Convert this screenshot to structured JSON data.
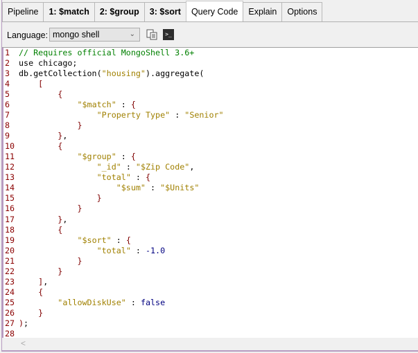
{
  "tabs": [
    {
      "label": "Pipeline",
      "bold": false
    },
    {
      "label": "1: $match",
      "bold": true
    },
    {
      "label": "2: $group",
      "bold": true
    },
    {
      "label": "3: $sort",
      "bold": true
    },
    {
      "label": "Query Code",
      "bold": false,
      "active": true
    },
    {
      "label": "Explain",
      "bold": false
    },
    {
      "label": "Options",
      "bold": false
    }
  ],
  "toolbar": {
    "language_label": "Language:",
    "language_value": "mongo shell"
  },
  "code": [
    [
      [
        "comment",
        "// Requires official MongoShell 3.6+"
      ]
    ],
    [
      [
        "plain",
        "use chicago;"
      ]
    ],
    [
      [
        "plain",
        "db.getCollection("
      ],
      [
        "string",
        "\"housing\""
      ],
      [
        "plain",
        ").aggregate("
      ]
    ],
    [
      [
        "plain",
        "    "
      ],
      [
        "brace",
        "["
      ]
    ],
    [
      [
        "plain",
        "        "
      ],
      [
        "brace",
        "{"
      ]
    ],
    [
      [
        "plain",
        "            "
      ],
      [
        "string",
        "\"$match\""
      ],
      [
        "plain",
        " : "
      ],
      [
        "brace",
        "{"
      ]
    ],
    [
      [
        "plain",
        "                "
      ],
      [
        "string",
        "\"Property Type\""
      ],
      [
        "plain",
        " : "
      ],
      [
        "string",
        "\"Senior\""
      ]
    ],
    [
      [
        "plain",
        "            "
      ],
      [
        "brace",
        "}"
      ]
    ],
    [
      [
        "plain",
        "        "
      ],
      [
        "brace",
        "}"
      ],
      [
        "plain",
        ","
      ]
    ],
    [
      [
        "plain",
        "        "
      ],
      [
        "brace",
        "{"
      ]
    ],
    [
      [
        "plain",
        "            "
      ],
      [
        "string",
        "\"$group\""
      ],
      [
        "plain",
        " : "
      ],
      [
        "brace",
        "{"
      ]
    ],
    [
      [
        "plain",
        "                "
      ],
      [
        "string",
        "\"_id\""
      ],
      [
        "plain",
        " : "
      ],
      [
        "string",
        "\"$Zip Code\""
      ],
      [
        "plain",
        ","
      ]
    ],
    [
      [
        "plain",
        "                "
      ],
      [
        "string",
        "\"total\""
      ],
      [
        "plain",
        " : "
      ],
      [
        "brace",
        "{"
      ]
    ],
    [
      [
        "plain",
        "                    "
      ],
      [
        "string",
        "\"$sum\""
      ],
      [
        "plain",
        " : "
      ],
      [
        "string",
        "\"$Units\""
      ]
    ],
    [
      [
        "plain",
        "                "
      ],
      [
        "brace",
        "}"
      ]
    ],
    [
      [
        "plain",
        "            "
      ],
      [
        "brace",
        "}"
      ]
    ],
    [
      [
        "plain",
        "        "
      ],
      [
        "brace",
        "}"
      ],
      [
        "plain",
        ","
      ]
    ],
    [
      [
        "plain",
        "        "
      ],
      [
        "brace",
        "{"
      ]
    ],
    [
      [
        "plain",
        "            "
      ],
      [
        "string",
        "\"$sort\""
      ],
      [
        "plain",
        " : "
      ],
      [
        "brace",
        "{"
      ]
    ],
    [
      [
        "plain",
        "                "
      ],
      [
        "string",
        "\"total\""
      ],
      [
        "plain",
        " : "
      ],
      [
        "number",
        "-1.0"
      ]
    ],
    [
      [
        "plain",
        "            "
      ],
      [
        "brace",
        "}"
      ]
    ],
    [
      [
        "plain",
        "        "
      ],
      [
        "brace",
        "}"
      ]
    ],
    [
      [
        "plain",
        "    "
      ],
      [
        "brace",
        "]"
      ],
      [
        "plain",
        ","
      ]
    ],
    [
      [
        "plain",
        "    "
      ],
      [
        "brace",
        "{"
      ]
    ],
    [
      [
        "plain",
        "        "
      ],
      [
        "string",
        "\"allowDiskUse\""
      ],
      [
        "plain",
        " : "
      ],
      [
        "keyword",
        "false"
      ]
    ],
    [
      [
        "plain",
        "    "
      ],
      [
        "brace",
        "}"
      ]
    ],
    [
      [
        "brace",
        ")"
      ],
      [
        "plain",
        ";"
      ]
    ],
    []
  ],
  "scroll_left": "<"
}
